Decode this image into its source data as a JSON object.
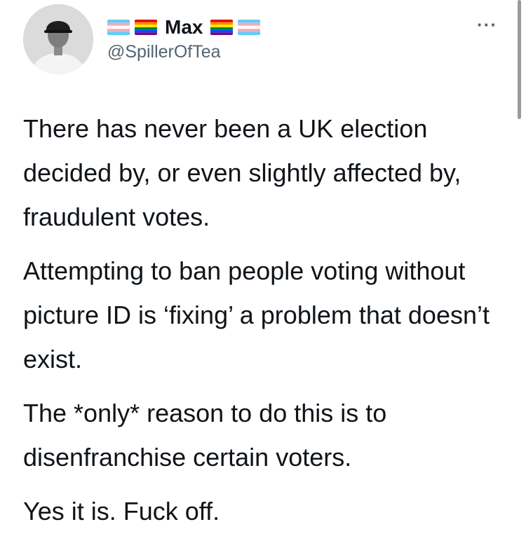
{
  "user": {
    "display_name": "Max",
    "handle": "@SpillerOfTea",
    "avatar_icon": "profile-photo"
  },
  "menu": {
    "more_label": "···"
  },
  "tweet": {
    "paragraphs": [
      "There has never been a UK election decided by, or even slightly affected by, fraudulent votes.",
      "Attempting to ban people voting without picture ID is ‘fixing’ a problem that doesn’t exist.",
      "The *only* reason to do this is to disenfranchise certain voters.",
      "Yes it is. Fuck off."
    ]
  },
  "colors": {
    "text": "#0f1419",
    "secondary": "#536471",
    "trans_blue": "#5bcefa",
    "trans_pink": "#f5a9b8",
    "pride": [
      "#e40303",
      "#ff8c00",
      "#ffed00",
      "#008026",
      "#004dff",
      "#750787"
    ]
  }
}
